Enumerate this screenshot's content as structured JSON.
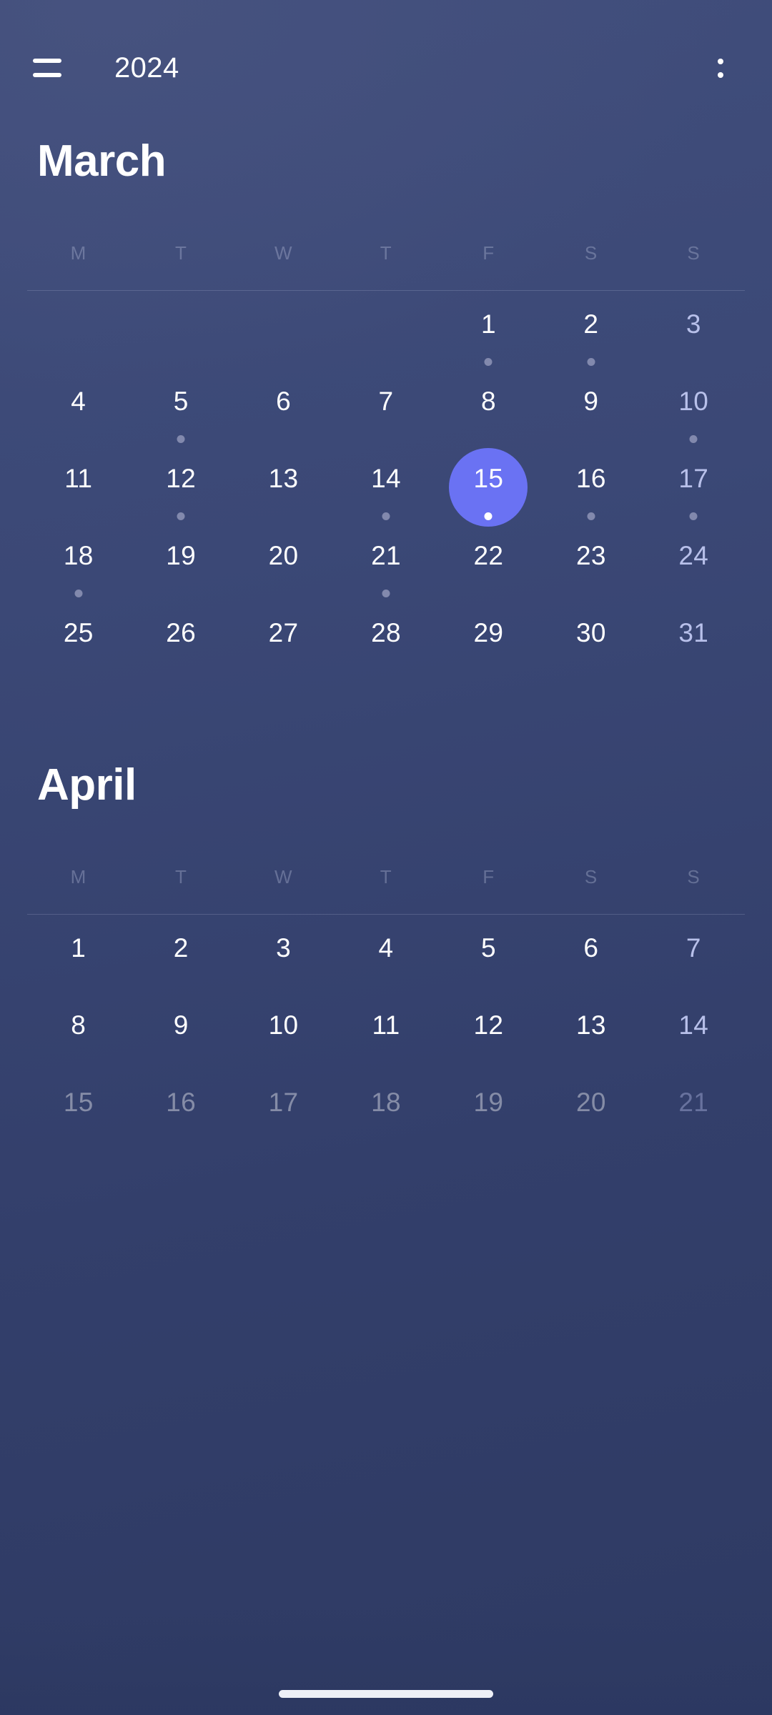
{
  "appbar": {
    "menu_icon": "hamburger-menu-icon",
    "title": "2024",
    "overflow_icon": "more-vertical-icon"
  },
  "weekday_labels": [
    "M",
    "T",
    "W",
    "T",
    "F",
    "S",
    "S"
  ],
  "colors": {
    "background_top": "#414e7c",
    "background_bottom": "#2e3a63",
    "accent_selected": "#6a72f3",
    "day_text": "#ffffff",
    "sunday_text": "#b8c0ea",
    "weekday_header_text": "#d0d6ee",
    "event_dot": "#8289ad",
    "selected_event_dot": "#ffffff"
  },
  "months": [
    {
      "name": "March",
      "lead_blanks": 4,
      "days": [
        {
          "n": "1",
          "sunday": false,
          "dot": true,
          "selected": false
        },
        {
          "n": "2",
          "sunday": false,
          "dot": true,
          "selected": false
        },
        {
          "n": "3",
          "sunday": true,
          "dot": false,
          "selected": false
        },
        {
          "n": "4",
          "sunday": false,
          "dot": false,
          "selected": false
        },
        {
          "n": "5",
          "sunday": false,
          "dot": true,
          "selected": false
        },
        {
          "n": "6",
          "sunday": false,
          "dot": false,
          "selected": false
        },
        {
          "n": "7",
          "sunday": false,
          "dot": false,
          "selected": false
        },
        {
          "n": "8",
          "sunday": false,
          "dot": false,
          "selected": false
        },
        {
          "n": "9",
          "sunday": false,
          "dot": false,
          "selected": false
        },
        {
          "n": "10",
          "sunday": true,
          "dot": true,
          "selected": false
        },
        {
          "n": "11",
          "sunday": false,
          "dot": false,
          "selected": false
        },
        {
          "n": "12",
          "sunday": false,
          "dot": true,
          "selected": false
        },
        {
          "n": "13",
          "sunday": false,
          "dot": false,
          "selected": false
        },
        {
          "n": "14",
          "sunday": false,
          "dot": true,
          "selected": false
        },
        {
          "n": "15",
          "sunday": false,
          "dot": true,
          "selected": true
        },
        {
          "n": "16",
          "sunday": false,
          "dot": true,
          "selected": false
        },
        {
          "n": "17",
          "sunday": true,
          "dot": true,
          "selected": false
        },
        {
          "n": "18",
          "sunday": false,
          "dot": true,
          "selected": false
        },
        {
          "n": "19",
          "sunday": false,
          "dot": false,
          "selected": false
        },
        {
          "n": "20",
          "sunday": false,
          "dot": false,
          "selected": false
        },
        {
          "n": "21",
          "sunday": false,
          "dot": true,
          "selected": false
        },
        {
          "n": "22",
          "sunday": false,
          "dot": false,
          "selected": false
        },
        {
          "n": "23",
          "sunday": false,
          "dot": false,
          "selected": false
        },
        {
          "n": "24",
          "sunday": true,
          "dot": false,
          "selected": false
        },
        {
          "n": "25",
          "sunday": false,
          "dot": false,
          "selected": false
        },
        {
          "n": "26",
          "sunday": false,
          "dot": false,
          "selected": false
        },
        {
          "n": "27",
          "sunday": false,
          "dot": false,
          "selected": false
        },
        {
          "n": "28",
          "sunday": false,
          "dot": false,
          "selected": false
        },
        {
          "n": "29",
          "sunday": false,
          "dot": false,
          "selected": false
        },
        {
          "n": "30",
          "sunday": false,
          "dot": false,
          "selected": false
        },
        {
          "n": "31",
          "sunday": true,
          "dot": false,
          "selected": false
        }
      ]
    },
    {
      "name": "April",
      "lead_blanks": 0,
      "days": [
        {
          "n": "1",
          "sunday": false,
          "dot": false,
          "selected": false
        },
        {
          "n": "2",
          "sunday": false,
          "dot": false,
          "selected": false
        },
        {
          "n": "3",
          "sunday": false,
          "dot": false,
          "selected": false
        },
        {
          "n": "4",
          "sunday": false,
          "dot": false,
          "selected": false
        },
        {
          "n": "5",
          "sunday": false,
          "dot": false,
          "selected": false
        },
        {
          "n": "6",
          "sunday": false,
          "dot": false,
          "selected": false
        },
        {
          "n": "7",
          "sunday": true,
          "dot": false,
          "selected": false
        },
        {
          "n": "8",
          "sunday": false,
          "dot": false,
          "selected": false
        },
        {
          "n": "9",
          "sunday": false,
          "dot": false,
          "selected": false
        },
        {
          "n": "10",
          "sunday": false,
          "dot": false,
          "selected": false
        },
        {
          "n": "11",
          "sunday": false,
          "dot": false,
          "selected": false
        },
        {
          "n": "12",
          "sunday": false,
          "dot": false,
          "selected": false
        },
        {
          "n": "13",
          "sunday": false,
          "dot": false,
          "selected": false
        },
        {
          "n": "14",
          "sunday": true,
          "dot": false,
          "selected": false
        },
        {
          "n": "15",
          "sunday": false,
          "dot": false,
          "selected": false
        },
        {
          "n": "16",
          "sunday": false,
          "dot": false,
          "selected": false
        },
        {
          "n": "17",
          "sunday": false,
          "dot": false,
          "selected": false
        },
        {
          "n": "18",
          "sunday": false,
          "dot": false,
          "selected": false
        },
        {
          "n": "19",
          "sunday": false,
          "dot": false,
          "selected": false
        },
        {
          "n": "20",
          "sunday": false,
          "dot": false,
          "selected": false
        },
        {
          "n": "21",
          "sunday": true,
          "dot": false,
          "selected": false
        }
      ]
    }
  ],
  "system": {
    "gesture_bar": "home-gesture-pill"
  }
}
